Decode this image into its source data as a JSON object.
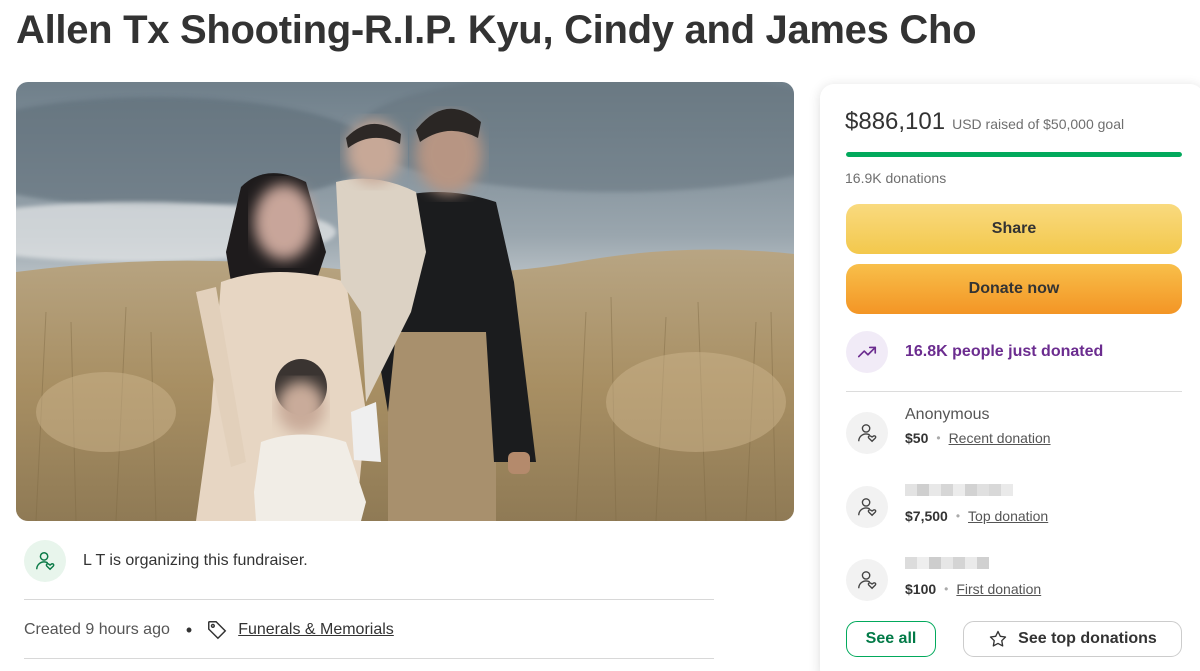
{
  "page": {
    "title": "Allen Tx Shooting-R.I.P. Kyu, Cindy and James Cho"
  },
  "organizer": {
    "text": "L T is organizing this fundraiser.",
    "icon": "heart-person-icon"
  },
  "meta": {
    "created": "Created 9 hours ago",
    "separator": "•",
    "category": "Funerals & Memorials",
    "category_icon": "tag-icon"
  },
  "sidebar": {
    "amount": "$886,101",
    "goal_text": "USD raised of $50,000 goal",
    "progress_fraction": 1.0,
    "donation_count": "16.9K donations",
    "share_label": "Share",
    "donate_label": "Donate now",
    "trend_text": "16.8K people just donated",
    "trend_icon": "trending-up-icon",
    "donors": [
      {
        "name": "Anonymous",
        "amount": "$50",
        "type": "Recent donation",
        "name_redacted": false
      },
      {
        "name": "",
        "amount": "$7,500",
        "type": "Top donation",
        "name_redacted": true
      },
      {
        "name": "",
        "amount": "$100",
        "type": "First donation",
        "name_redacted": true
      }
    ],
    "see_all_label": "See all",
    "see_top_label": "See top donations",
    "star_icon": "star-icon"
  },
  "colors": {
    "brand_green": "#02a95c",
    "share_yellow": "#f3c84c",
    "donate_orange": "#f39525",
    "trend_purple": "#6b2c8f"
  }
}
